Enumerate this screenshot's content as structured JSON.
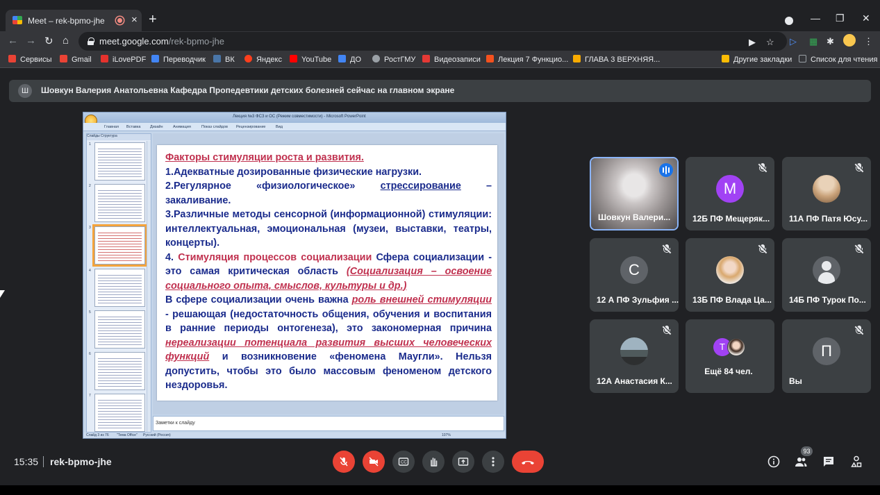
{
  "browser": {
    "tab_title": "Meet – rek-bpmo-jhe",
    "url_host": "meet.google.com",
    "url_path": "/rek-bpmo-jhe",
    "new_tab": "+",
    "win_min": "—",
    "win_max": "❐",
    "win_close": "✕"
  },
  "bookmarks": [
    {
      "label": "Сервисы",
      "color": "#ea4335"
    },
    {
      "label": "Gmail",
      "color": "#ea4335"
    },
    {
      "label": "iLovePDF",
      "color": "#e5322d"
    },
    {
      "label": "Переводчик",
      "color": "#4285f4"
    },
    {
      "label": "ВК",
      "color": "#4a76a8"
    },
    {
      "label": "Яндекс",
      "color": "#fc3f1d"
    },
    {
      "label": "YouTube",
      "color": "#ff0000"
    },
    {
      "label": "ДО",
      "color": "#4285f4"
    },
    {
      "label": "РостГМУ",
      "color": "#5f6368"
    },
    {
      "label": "Видеозаписи",
      "color": "#e53935"
    },
    {
      "label": "Лекция 7 Функцио...",
      "color": "#f4511e"
    },
    {
      "label": "ГЛАВА 3 ВЕРХНЯЯ...",
      "color": "#f9ab00"
    },
    {
      "label": "Другие закладки",
      "color": "#fbbc04"
    },
    {
      "label": "Список для чтения",
      "color": "#9aa0a6"
    }
  ],
  "meet": {
    "banner_avatar": "Ш",
    "banner_text": "Шовкун Валерия Анатольевна Кафедра Пропедевтики детских болезней сейчас на главном экране",
    "time": "15:35",
    "meeting_code": "rek-bpmo-jhe",
    "participants_count": "93"
  },
  "presentation": {
    "window_title": "Лекция №3 ФСЗ и ОС (Режим совместимости) - Microsoft PowerPoint",
    "ribbon_tabs": [
      "Главная",
      "Вставка",
      "Дизайн",
      "Анимация",
      "Показ слайдов",
      "Рецензирование",
      "Вид"
    ],
    "pane_tabs": "Слайды   Структура",
    "notes_placeholder": "Заметки к слайду",
    "status_slide": "Слайд 3 из 76",
    "status_theme": "\"Тема Office\"",
    "status_lang": "Русский (Россия)",
    "status_zoom": "107%",
    "slide": {
      "title": "Факторы стимуляции роста и развития.",
      "p1": "1.Адекватные дозированные физические нагрузки.",
      "p2a": "2.Регулярное «физиологическое» ",
      "p2b": "стрессирование",
      "p2c": " – закаливание.",
      "p3": "3.Различные методы сенсорной (информационной) стимуляции: интеллектуальная, эмоциональная (музеи, выставки, театры, концерты).",
      "p4a": " 4. ",
      "p4b": "Стимуляция процессов социализации",
      "p4c": " Сфера социализации - это самая критическая область ",
      "p4d": "(Социализация – освоение социального опыта, смыслов, культуры и др.)",
      "p5a": " В сфере социализации очень важна ",
      "p5b": "роль внешней стимуляции ",
      "p5c": " - решающая (недостаточность общения, обучения и воспитания в ранние периоды онтогенеза), это закономерная причина ",
      "p5d": "нереализации потенциала развития высших человеческих функций",
      "p5e": " и возникновение «феномена Маугли». Нельзя допустить, чтобы это было массовым феноменом детского нездоровья."
    }
  },
  "participants": [
    {
      "name": "Шовкун Валери...",
      "type": "video",
      "speaking": true
    },
    {
      "name": "12Б ПФ Мещеряк...",
      "type": "letter",
      "letter": "M",
      "color": "#a142f4"
    },
    {
      "name": "11А ПФ Патя Юсу...",
      "type": "photo",
      "color": "#c9a27a"
    },
    {
      "name": "12 А ПФ Зульфия ...",
      "type": "letter",
      "letter": "С",
      "color": "#5f6368"
    },
    {
      "name": "13Б ПФ Влада Ца...",
      "type": "photo",
      "color": "#e6c3a5"
    },
    {
      "name": "14Б ПФ Турок По...",
      "type": "icon"
    },
    {
      "name": "12А Анастасия К...",
      "type": "photo",
      "color": "#7a8a8f"
    },
    {
      "name": "Ещё 84 чел.",
      "type": "more",
      "letter": "T"
    },
    {
      "name": "Вы",
      "type": "letter",
      "letter": "П",
      "color": "#5f6368"
    }
  ]
}
